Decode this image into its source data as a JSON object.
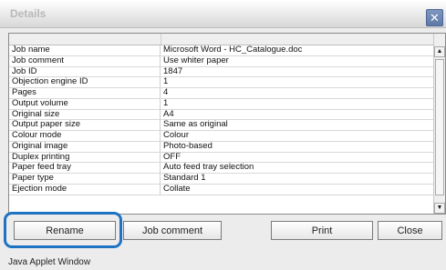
{
  "window": {
    "title": "Details",
    "close_glyph": "✕"
  },
  "table": {
    "rows": [
      {
        "label": "Job name",
        "value": "Microsoft Word - HC_Catalogue.doc"
      },
      {
        "label": "Job comment",
        "value": "Use whiter paper"
      },
      {
        "label": "Job ID",
        "value": "1847"
      },
      {
        "label": "Objection engine ID",
        "value": "1"
      },
      {
        "label": "Pages",
        "value": "4"
      },
      {
        "label": "Output volume",
        "value": "1"
      },
      {
        "label": "Original size",
        "value": "A4"
      },
      {
        "label": "Output paper size",
        "value": "Same as original"
      },
      {
        "label": "Colour mode",
        "value": "Colour"
      },
      {
        "label": "Original image",
        "value": "Photo-based"
      },
      {
        "label": "Duplex printing",
        "value": "OFF"
      },
      {
        "label": "Paper feed tray",
        "value": "Auto feed tray selection"
      },
      {
        "label": "Paper type",
        "value": "Standard 1"
      },
      {
        "label": "Ejection mode",
        "value": "Collate"
      }
    ],
    "scroll_up_glyph": "▲",
    "scroll_down_glyph": "▼"
  },
  "buttons": {
    "rename": "Rename",
    "job_comment": "Job comment",
    "print": "Print",
    "close": "Close"
  },
  "status": {
    "text": "Java Applet Window"
  },
  "colors": {
    "highlight": "#1d73c2"
  }
}
